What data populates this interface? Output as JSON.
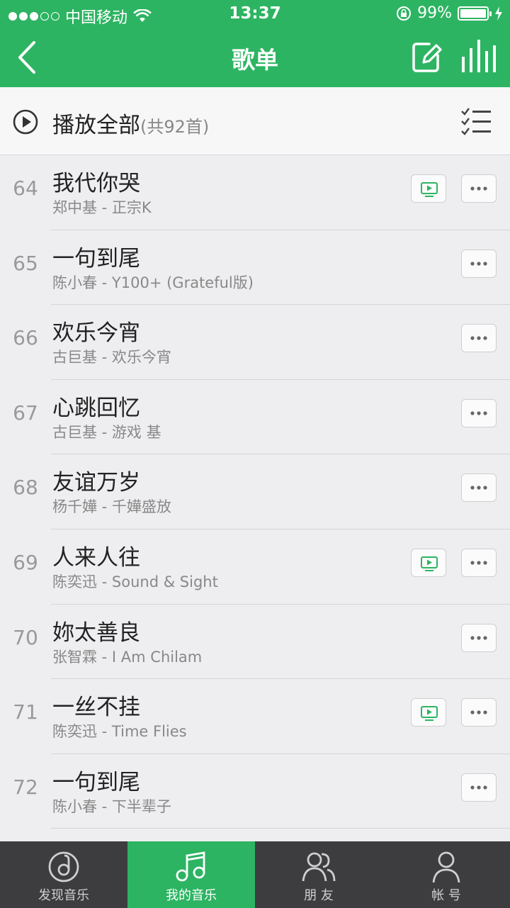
{
  "status": {
    "carrier": "中国移动",
    "time": "13:37",
    "battery": "99%",
    "battery_level": 0.99
  },
  "nav": {
    "title": "歌单"
  },
  "playall": {
    "label": "播放全部",
    "count": "(共92首)"
  },
  "songs": [
    {
      "num": "64",
      "title": "我代你哭",
      "subtitle": "郑中基 - 正宗K",
      "mv": true
    },
    {
      "num": "65",
      "title": "一句到尾",
      "subtitle": "陈小春 - Y100+ (Grateful版)",
      "mv": false
    },
    {
      "num": "66",
      "title": "欢乐今宵",
      "subtitle": "古巨基 - 欢乐今宵",
      "mv": false
    },
    {
      "num": "67",
      "title": "心跳回忆",
      "subtitle": "古巨基 - 游戏 基",
      "mv": false
    },
    {
      "num": "68",
      "title": "友谊万岁",
      "subtitle": "杨千嬅 - 千嬅盛放",
      "mv": false
    },
    {
      "num": "69",
      "title": "人来人往",
      "subtitle": "陈奕迅 - Sound & Sight",
      "mv": true
    },
    {
      "num": "70",
      "title": "妳太善良",
      "subtitle": "张智霖 - I Am Chilam",
      "mv": false
    },
    {
      "num": "71",
      "title": "一丝不挂",
      "subtitle": "陈奕迅 - Time Flies",
      "mv": true
    },
    {
      "num": "72",
      "title": "一句到尾",
      "subtitle": "陈小春 - 下半辈子",
      "mv": false
    }
  ],
  "tabs": [
    {
      "label": "发现音乐",
      "icon": "disc-icon"
    },
    {
      "label": "我的音乐",
      "icon": "music-note-icon"
    },
    {
      "label": "朋 友",
      "icon": "friends-icon"
    },
    {
      "label": "帐 号",
      "icon": "account-icon"
    }
  ],
  "colors": {
    "accent": "#2db462",
    "tabbar": "#3d3d40"
  }
}
